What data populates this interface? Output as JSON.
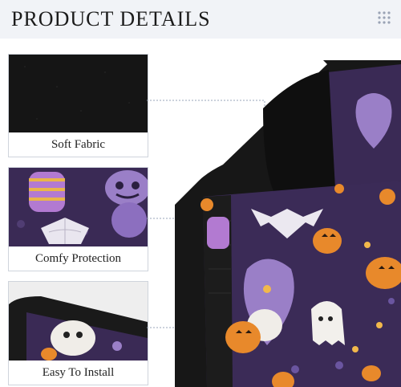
{
  "header": {
    "title": "PRODUCT DETAILS"
  },
  "panels": [
    {
      "caption": "Soft Fabric"
    },
    {
      "caption": "Comfy Protection"
    },
    {
      "caption": "Easy To Install"
    }
  ],
  "colors": {
    "fabric_purple": "#3a2a55",
    "lilac": "#9a7fc7",
    "pumpkin": "#e8892b",
    "black_fabric": "#161616",
    "header_bg": "#f1f3f7"
  }
}
